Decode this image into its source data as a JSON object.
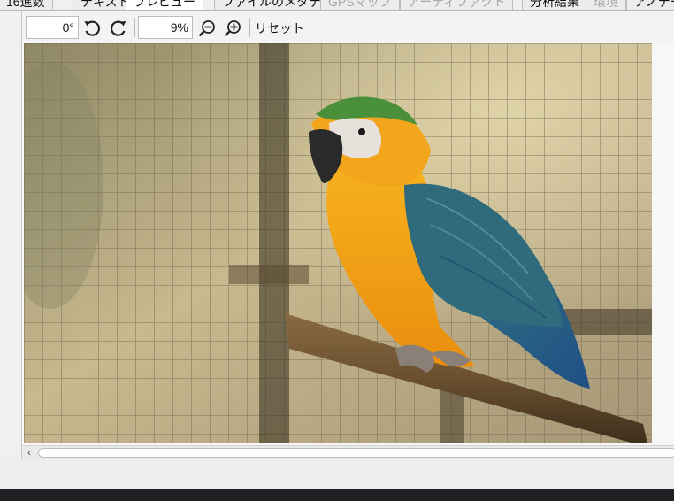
{
  "tabs": [
    {
      "label": "16進数",
      "state": "normal"
    },
    {
      "label": "テキスト",
      "state": "normal"
    },
    {
      "label": "プレビュー",
      "state": "active"
    },
    {
      "label": "ファイルのメタデータ",
      "state": "normal"
    },
    {
      "label": "GPSマップ",
      "state": "disabled"
    },
    {
      "label": "アーティファクト",
      "state": "disabled"
    },
    {
      "label": "分析結果",
      "state": "normal"
    },
    {
      "label": "環境",
      "state": "disabled"
    },
    {
      "label": "アノテーション",
      "state": "normal"
    }
  ],
  "toolbar": {
    "rotation_value": "0°",
    "zoom_value": "9%",
    "reset_label": "リセット",
    "icons": {
      "rotate_left": "rotate-left-icon",
      "rotate_right": "rotate-right-icon",
      "zoom_out": "zoom-out-icon",
      "zoom_in": "zoom-in-icon"
    }
  },
  "preview": {
    "subject": "macaw parrot on perch",
    "colors": {
      "cage_bg": "#b7a980",
      "perch": "#6a5030",
      "parrot_yellow": "#f3a51b",
      "parrot_blue": "#2d6c88",
      "parrot_green": "#4a8f3a"
    }
  },
  "scrollbar": {
    "left_arrow": "‹"
  },
  "ui_colors": {
    "background": "#f0f0f0",
    "taskbar": "#202124"
  }
}
